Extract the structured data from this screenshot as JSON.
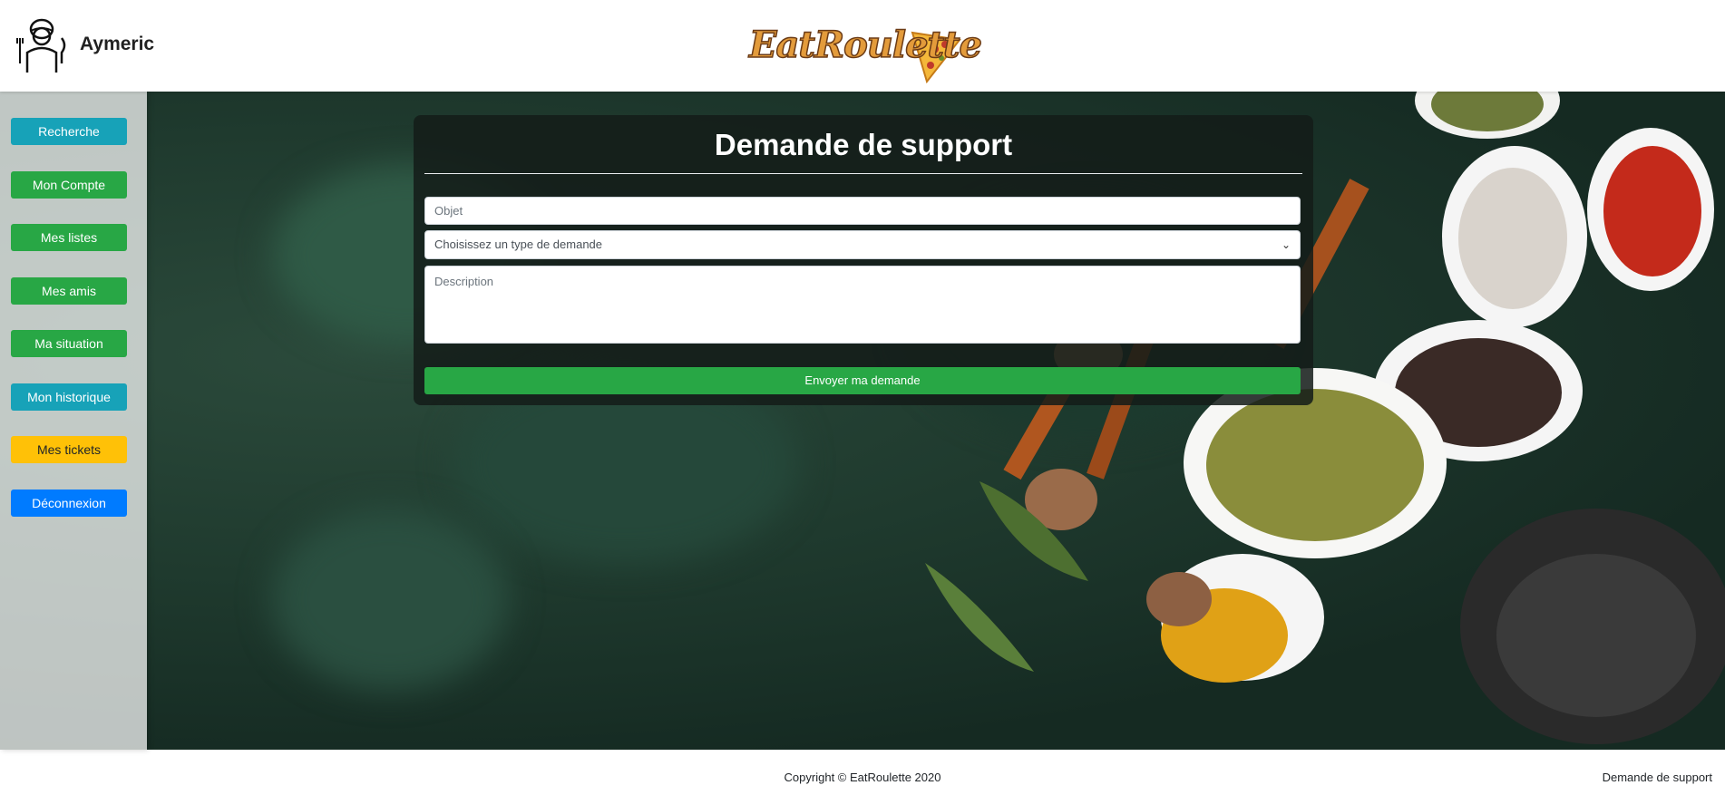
{
  "header": {
    "username": "Aymeric",
    "logo_text": "EatRoulette"
  },
  "sidebar": {
    "items": [
      {
        "label": "Recherche",
        "color": "#17a2b8"
      },
      {
        "label": "Mon Compte",
        "color": "#28a745"
      },
      {
        "label": "Mes listes",
        "color": "#28a745"
      },
      {
        "label": "Mes amis",
        "color": "#28a745"
      },
      {
        "label": "Ma situation",
        "color": "#28a745"
      },
      {
        "label": "Mon historique",
        "color": "#17a2b8"
      },
      {
        "label": "Mes tickets",
        "color": "#ffc107"
      },
      {
        "label": "Déconnexion",
        "color": "#007bff"
      }
    ]
  },
  "form": {
    "title": "Demande de support",
    "objet_placeholder": "Objet",
    "type_selected": "Choisissez un type de demande",
    "description_placeholder": "Description",
    "submit_label": "Envoyer ma demande"
  },
  "footer": {
    "copyright": "Copyright © EatRoulette 2020",
    "link_label": "Demande de support"
  },
  "icons": {
    "avatar": "chef-avatar-icon",
    "select": "chevron-down-icon"
  }
}
